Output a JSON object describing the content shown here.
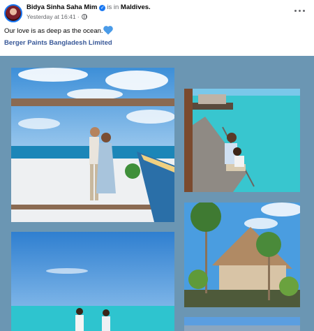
{
  "post": {
    "author": "Bidya Sinha Saha Mim",
    "is_in": "is in",
    "place": "Maldives.",
    "timestamp": "Yesterday at 16:41 ·",
    "caption": "Our love is as deep as the ocean.",
    "tagged_page": "Berger Paints Bangladesh Limited"
  },
  "icons": {
    "verified": "verified-badge-icon",
    "audience": "globe-icon",
    "emoji": "blue-heart-icon",
    "more": "more-options-icon"
  },
  "colors": {
    "brand_blue": "#1877f2",
    "link": "#385898",
    "album_background": "#6b96b3",
    "secondary_text": "#65676b"
  },
  "album": {
    "photos": [
      {
        "subject": "couple kissing on beach under wooden frame with blue boat"
      },
      {
        "subject": "couple sitting on wooden jetty steps by turquoise lagoon"
      },
      {
        "subject": "thatched-roof villa among palm trees"
      },
      {
        "subject": "couple walking in shallow sea"
      },
      {
        "subject": "partial photo of sea and sky"
      }
    ]
  }
}
